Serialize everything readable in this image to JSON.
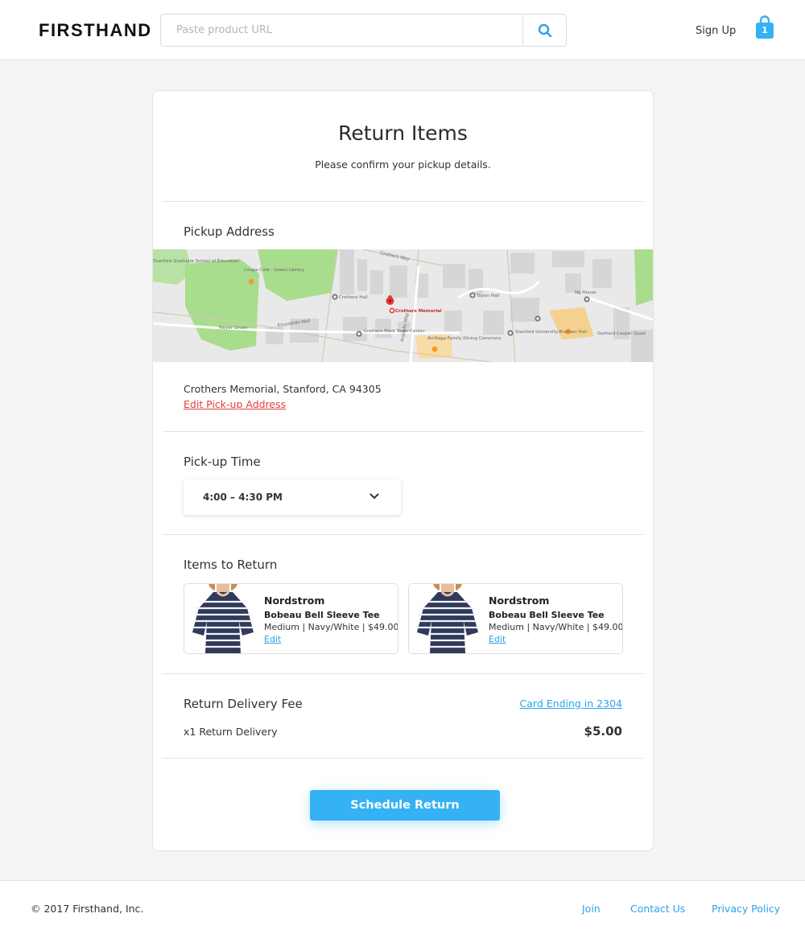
{
  "header": {
    "logo": "FIRSTHAND",
    "search_placeholder": "Paste product URL",
    "search_value": "",
    "signup_label": "Sign Up",
    "cart_count": "1"
  },
  "page": {
    "title": "Return Items",
    "subtitle": "Please confirm your pickup details."
  },
  "pickup": {
    "heading": "Pickup Address",
    "map_labels": {
      "library": "Coupa Cafe - Green Library",
      "school": "Stanford Graduate School of Education",
      "crothers_hall": "Crothers Hall",
      "marker": "Crothers Memorial",
      "mark_taper": "Crothers Mark Taper Center",
      "arrillaga": "Arrillaga Family Dining Commons",
      "toyon": "Toyon Hall",
      "ng_house": "Ng House",
      "branner": "Stanford University-Branner Hall",
      "gerhard": "Gerhard Casper Quad",
      "meyer": "Meyer Green",
      "escondido": "Escondido Mall",
      "crothers_way": "Crothers Way",
      "arguello": "Arguello Way"
    },
    "address": "Crothers Memorial, Stanford, CA 94305",
    "edit_label": "Edit Pick-up Address"
  },
  "time": {
    "heading": "Pick-up Time",
    "selected": "4:00 – 4:30 PM"
  },
  "items": {
    "heading": "Items to Return",
    "list": [
      {
        "brand": "Nordstrom",
        "name": "Bobeau Bell Sleeve Tee",
        "meta": "Medium | Navy/White | $49.00",
        "edit": "Edit"
      },
      {
        "brand": "Nordstrom",
        "name": "Bobeau Bell Sleeve Tee",
        "meta": "Medium | Navy/White | $49.00",
        "edit": "Edit"
      }
    ]
  },
  "fee": {
    "heading": "Return Delivery Fee",
    "card_label": "Card Ending in 2304",
    "line_label": "x1 Return Delivery",
    "amount": "$5.00"
  },
  "cta_label": "Schedule Return",
  "footer": {
    "copyright": "© 2017 Firsthand, Inc.",
    "join": "Join",
    "contact": "Contact Us",
    "privacy": "Privacy Policy"
  },
  "colors": {
    "accent": "#35b2f4",
    "link": "#2aa4e9",
    "danger_link": "#e0403a",
    "map_park": "#a8dd8e",
    "map_marker": "#e53935"
  }
}
